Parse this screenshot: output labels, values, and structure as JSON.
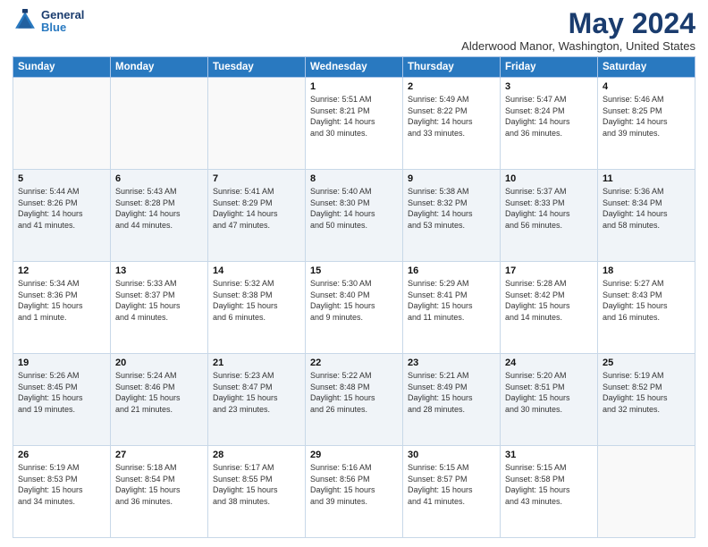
{
  "header": {
    "logo_line1": "General",
    "logo_line2": "Blue",
    "month": "May 2024",
    "location": "Alderwood Manor, Washington, United States"
  },
  "weekdays": [
    "Sunday",
    "Monday",
    "Tuesday",
    "Wednesday",
    "Thursday",
    "Friday",
    "Saturday"
  ],
  "weeks": [
    [
      {
        "day": "",
        "info": ""
      },
      {
        "day": "",
        "info": ""
      },
      {
        "day": "",
        "info": ""
      },
      {
        "day": "1",
        "info": "Sunrise: 5:51 AM\nSunset: 8:21 PM\nDaylight: 14 hours\nand 30 minutes."
      },
      {
        "day": "2",
        "info": "Sunrise: 5:49 AM\nSunset: 8:22 PM\nDaylight: 14 hours\nand 33 minutes."
      },
      {
        "day": "3",
        "info": "Sunrise: 5:47 AM\nSunset: 8:24 PM\nDaylight: 14 hours\nand 36 minutes."
      },
      {
        "day": "4",
        "info": "Sunrise: 5:46 AM\nSunset: 8:25 PM\nDaylight: 14 hours\nand 39 minutes."
      }
    ],
    [
      {
        "day": "5",
        "info": "Sunrise: 5:44 AM\nSunset: 8:26 PM\nDaylight: 14 hours\nand 41 minutes."
      },
      {
        "day": "6",
        "info": "Sunrise: 5:43 AM\nSunset: 8:28 PM\nDaylight: 14 hours\nand 44 minutes."
      },
      {
        "day": "7",
        "info": "Sunrise: 5:41 AM\nSunset: 8:29 PM\nDaylight: 14 hours\nand 47 minutes."
      },
      {
        "day": "8",
        "info": "Sunrise: 5:40 AM\nSunset: 8:30 PM\nDaylight: 14 hours\nand 50 minutes."
      },
      {
        "day": "9",
        "info": "Sunrise: 5:38 AM\nSunset: 8:32 PM\nDaylight: 14 hours\nand 53 minutes."
      },
      {
        "day": "10",
        "info": "Sunrise: 5:37 AM\nSunset: 8:33 PM\nDaylight: 14 hours\nand 56 minutes."
      },
      {
        "day": "11",
        "info": "Sunrise: 5:36 AM\nSunset: 8:34 PM\nDaylight: 14 hours\nand 58 minutes."
      }
    ],
    [
      {
        "day": "12",
        "info": "Sunrise: 5:34 AM\nSunset: 8:36 PM\nDaylight: 15 hours\nand 1 minute."
      },
      {
        "day": "13",
        "info": "Sunrise: 5:33 AM\nSunset: 8:37 PM\nDaylight: 15 hours\nand 4 minutes."
      },
      {
        "day": "14",
        "info": "Sunrise: 5:32 AM\nSunset: 8:38 PM\nDaylight: 15 hours\nand 6 minutes."
      },
      {
        "day": "15",
        "info": "Sunrise: 5:30 AM\nSunset: 8:40 PM\nDaylight: 15 hours\nand 9 minutes."
      },
      {
        "day": "16",
        "info": "Sunrise: 5:29 AM\nSunset: 8:41 PM\nDaylight: 15 hours\nand 11 minutes."
      },
      {
        "day": "17",
        "info": "Sunrise: 5:28 AM\nSunset: 8:42 PM\nDaylight: 15 hours\nand 14 minutes."
      },
      {
        "day": "18",
        "info": "Sunrise: 5:27 AM\nSunset: 8:43 PM\nDaylight: 15 hours\nand 16 minutes."
      }
    ],
    [
      {
        "day": "19",
        "info": "Sunrise: 5:26 AM\nSunset: 8:45 PM\nDaylight: 15 hours\nand 19 minutes."
      },
      {
        "day": "20",
        "info": "Sunrise: 5:24 AM\nSunset: 8:46 PM\nDaylight: 15 hours\nand 21 minutes."
      },
      {
        "day": "21",
        "info": "Sunrise: 5:23 AM\nSunset: 8:47 PM\nDaylight: 15 hours\nand 23 minutes."
      },
      {
        "day": "22",
        "info": "Sunrise: 5:22 AM\nSunset: 8:48 PM\nDaylight: 15 hours\nand 26 minutes."
      },
      {
        "day": "23",
        "info": "Sunrise: 5:21 AM\nSunset: 8:49 PM\nDaylight: 15 hours\nand 28 minutes."
      },
      {
        "day": "24",
        "info": "Sunrise: 5:20 AM\nSunset: 8:51 PM\nDaylight: 15 hours\nand 30 minutes."
      },
      {
        "day": "25",
        "info": "Sunrise: 5:19 AM\nSunset: 8:52 PM\nDaylight: 15 hours\nand 32 minutes."
      }
    ],
    [
      {
        "day": "26",
        "info": "Sunrise: 5:19 AM\nSunset: 8:53 PM\nDaylight: 15 hours\nand 34 minutes."
      },
      {
        "day": "27",
        "info": "Sunrise: 5:18 AM\nSunset: 8:54 PM\nDaylight: 15 hours\nand 36 minutes."
      },
      {
        "day": "28",
        "info": "Sunrise: 5:17 AM\nSunset: 8:55 PM\nDaylight: 15 hours\nand 38 minutes."
      },
      {
        "day": "29",
        "info": "Sunrise: 5:16 AM\nSunset: 8:56 PM\nDaylight: 15 hours\nand 39 minutes."
      },
      {
        "day": "30",
        "info": "Sunrise: 5:15 AM\nSunset: 8:57 PM\nDaylight: 15 hours\nand 41 minutes."
      },
      {
        "day": "31",
        "info": "Sunrise: 5:15 AM\nSunset: 8:58 PM\nDaylight: 15 hours\nand 43 minutes."
      },
      {
        "day": "",
        "info": ""
      }
    ]
  ]
}
